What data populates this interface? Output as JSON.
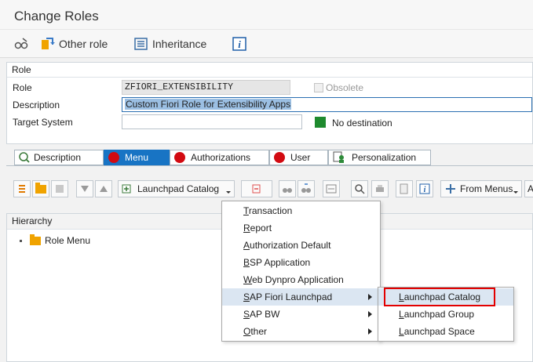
{
  "window": {
    "title": "Change Roles"
  },
  "app_toolbar": {
    "other_role": "Other role",
    "inheritance": "Inheritance"
  },
  "role_section": {
    "header": "Role",
    "role_label": "Role",
    "role_value": "ZFIORI_EXTENSIBILITY",
    "obsolete_label": "Obsolete",
    "description_label": "Description",
    "description_value": "Custom Fiori Role for Extensibility Apps",
    "target_system_label": "Target System",
    "target_system_value": "",
    "destination_status": "No destination",
    "destination_status_color": "#1e8a2e"
  },
  "tabs": [
    {
      "label": "Description"
    },
    {
      "label": "Menu",
      "active": true
    },
    {
      "label": "Authorizations"
    },
    {
      "label": "User"
    },
    {
      "label": "Personalization"
    }
  ],
  "menu_toolbar": {
    "launchpad_catalog": "Launchpad Catalog",
    "from_menus": "From Menus",
    "trailing": "A"
  },
  "hierarchy": {
    "header": "Hierarchy",
    "root": "Role Menu"
  },
  "context_menu": {
    "items": [
      {
        "first": "T",
        "rest": "ransaction"
      },
      {
        "first": "R",
        "rest": "eport"
      },
      {
        "first": "A",
        "rest": "uthorization Default"
      },
      {
        "first": "B",
        "rest": "SP Application"
      },
      {
        "first": "W",
        "rest": "eb Dynpro Application"
      },
      {
        "first": "S",
        "rest": "AP Fiori Launchpad",
        "highlighted": true,
        "submenu": true
      },
      {
        "first": "S",
        "rest": "AP BW",
        "submenu": true
      },
      {
        "first": "O",
        "rest": "ther",
        "submenu": true
      }
    ]
  },
  "submenu": {
    "items": [
      {
        "first": "L",
        "rest": "aunchpad Catalog",
        "highlighted": true
      },
      {
        "first": "L",
        "rest": "aunchpad Group"
      },
      {
        "first": "L",
        "rest": "aunchpad Space"
      }
    ]
  },
  "colors": {
    "accent": "#1874c4",
    "status_red": "#d20a11",
    "highlight_box": "#e30000"
  }
}
